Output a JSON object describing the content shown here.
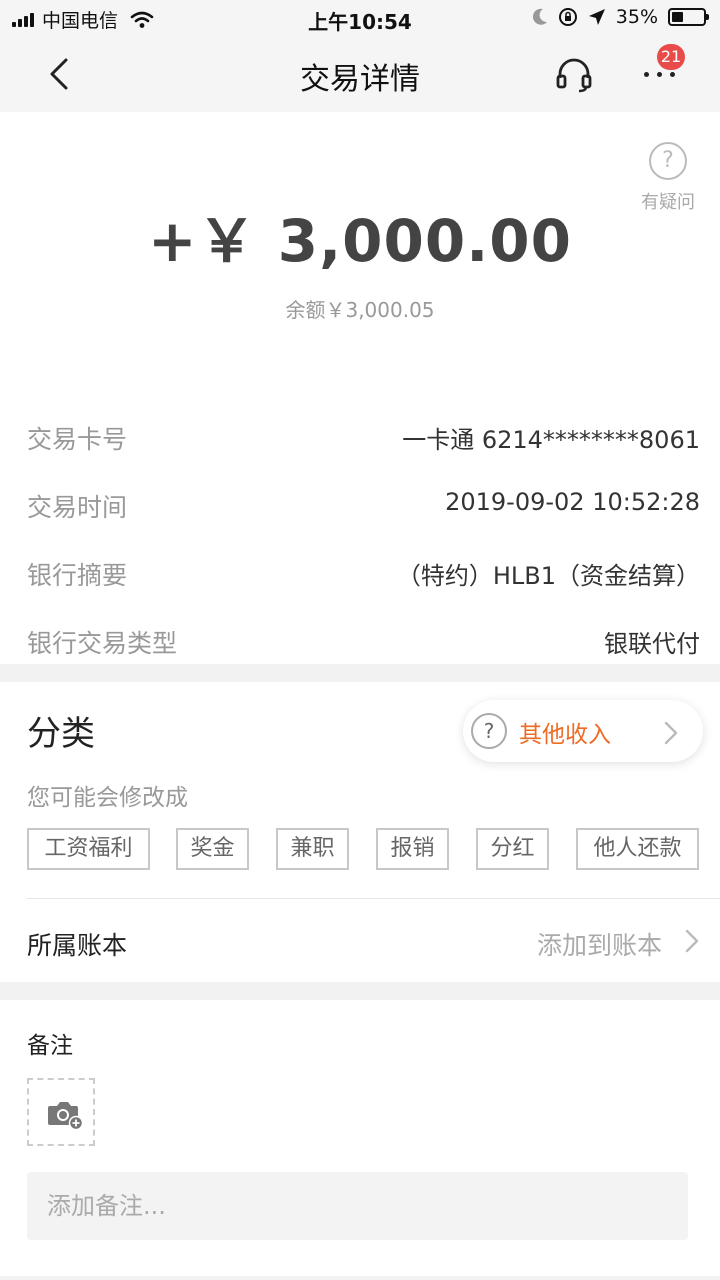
{
  "status_bar": {
    "carrier": "中国电信",
    "time": "上午10:54",
    "battery": "35%",
    "battery_level": 0.35
  },
  "nav": {
    "title": "交易详情",
    "badge_count": "21",
    "icons": [
      "chevron-left-icon",
      "headset-icon",
      "more-icon"
    ]
  },
  "summary": {
    "help_label": "有疑问",
    "amount": "+￥ 3,000.00",
    "balance": "余额￥3,000.05"
  },
  "details": [
    {
      "label": "交易卡号",
      "value": "一卡通 6214********8061"
    },
    {
      "label": "交易时间",
      "value": "2019-09-02 10:52:28"
    },
    {
      "label": "银行摘要",
      "value": "（特约）HLB1（资金结算）"
    },
    {
      "label": "银行交易类型",
      "value": "银联代付"
    }
  ],
  "category": {
    "title": "分类",
    "current": "其他收入",
    "suggest_label": "您可能会修改成",
    "tags": [
      "工资福利",
      "奖金",
      "兼职",
      "报销",
      "分红",
      "他人还款"
    ]
  },
  "ledger": {
    "label": "所属账本",
    "value": "添加到账本"
  },
  "note": {
    "label": "备注",
    "placeholder": "添加备注..."
  },
  "colors": {
    "accent": "#ee6b24",
    "badge": "#e94b4b"
  }
}
